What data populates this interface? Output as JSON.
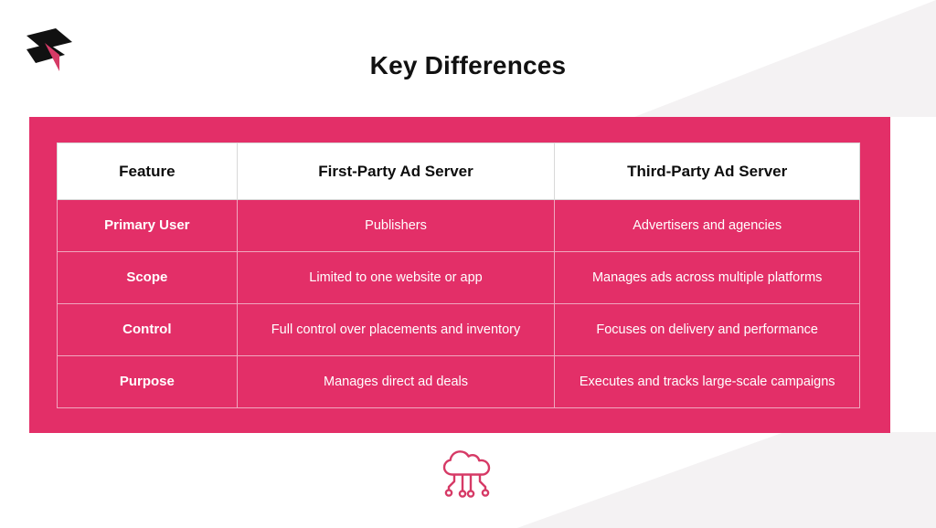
{
  "slide": {
    "title": "Key Differences",
    "logo_icon": "stacked-bars-arrow-logo",
    "footer_icon": "cloud-computing-icon"
  },
  "colors": {
    "accent_pink": "#e32f68",
    "logo_black": "#111111",
    "logo_pink": "#d63a66",
    "title_text": "#111111",
    "panel_wedge_gray": "#f4f2f3",
    "header_bg": "#ffffff",
    "cell_text": "#ffffff",
    "grid_line": "#f0a7bf"
  },
  "table": {
    "headers": [
      "Feature",
      "First-Party Ad Server",
      "Third-Party Ad Server"
    ],
    "rows": [
      {
        "feature": "Primary User",
        "first_party": "Publishers",
        "third_party": "Advertisers and agencies"
      },
      {
        "feature": "Scope",
        "first_party": "Limited to one website or app",
        "third_party": "Manages ads across multiple platforms"
      },
      {
        "feature": "Control",
        "first_party": "Full control over placements and inventory",
        "third_party": "Focuses on delivery and performance"
      },
      {
        "feature": "Purpose",
        "first_party": "Manages direct ad deals",
        "third_party": "Executes and tracks large-scale campaigns"
      }
    ]
  }
}
